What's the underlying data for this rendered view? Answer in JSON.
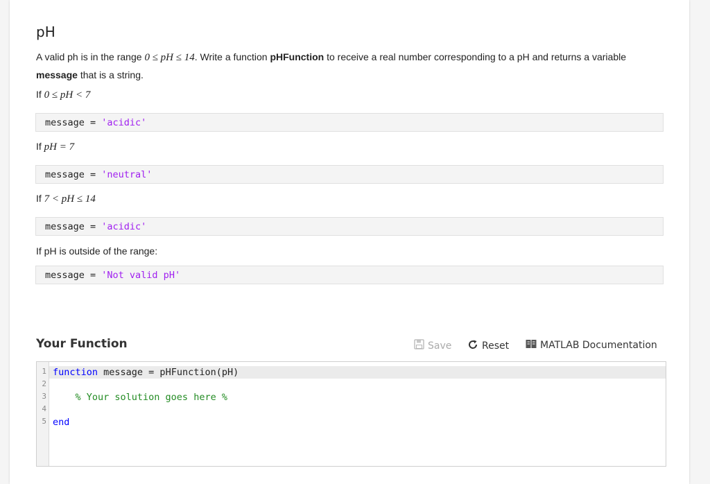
{
  "problem": {
    "title": "pH",
    "intro_1": "A valid ph is in the range ",
    "intro_math": "0 ≤ pH ≤ 14",
    "intro_2": ". Write a function ",
    "function_name": "pHFunction",
    "intro_3": " to receive a real number corresponding to a pH and returns a variable",
    "intro_line2_bold": "message",
    "intro_line2_rest": " that is a string.",
    "cond1_prefix": "If ",
    "cond1_math": "0 ≤ pH < 7",
    "code1_var": "message = ",
    "code1_str": "'acidic'",
    "cond2_prefix": "If ",
    "cond2_math": "pH = 7",
    "code2_var": "message = ",
    "code2_str": "'neutral'",
    "cond3_prefix": "If ",
    "cond3_math": "7 < pH ≤ 14",
    "code3_var": "message = ",
    "code3_str": "'acidic'",
    "cond4_text": "If pH is outside of the range:",
    "code4_var": "message = ",
    "code4_str": "'Not valid pH'"
  },
  "your_function": {
    "title": "Your Function",
    "save_label": "Save",
    "reset_label": "Reset",
    "docs_label": "MATLAB Documentation"
  },
  "editor": {
    "line_numbers": [
      "1",
      "2",
      "3",
      "4",
      "5"
    ],
    "line1_kw": "function",
    "line1_rest": " message = pHFunction(pH)",
    "line3_comment": "    % Your solution goes here %",
    "line5_kw": "end"
  },
  "colors": {
    "string": "#a020f0",
    "keyword": "#0000ff",
    "comment": "#228b22"
  },
  "icons": {
    "save": "floppy-disk-icon",
    "reset": "circular-arrow-icon",
    "docs": "book-icon"
  }
}
